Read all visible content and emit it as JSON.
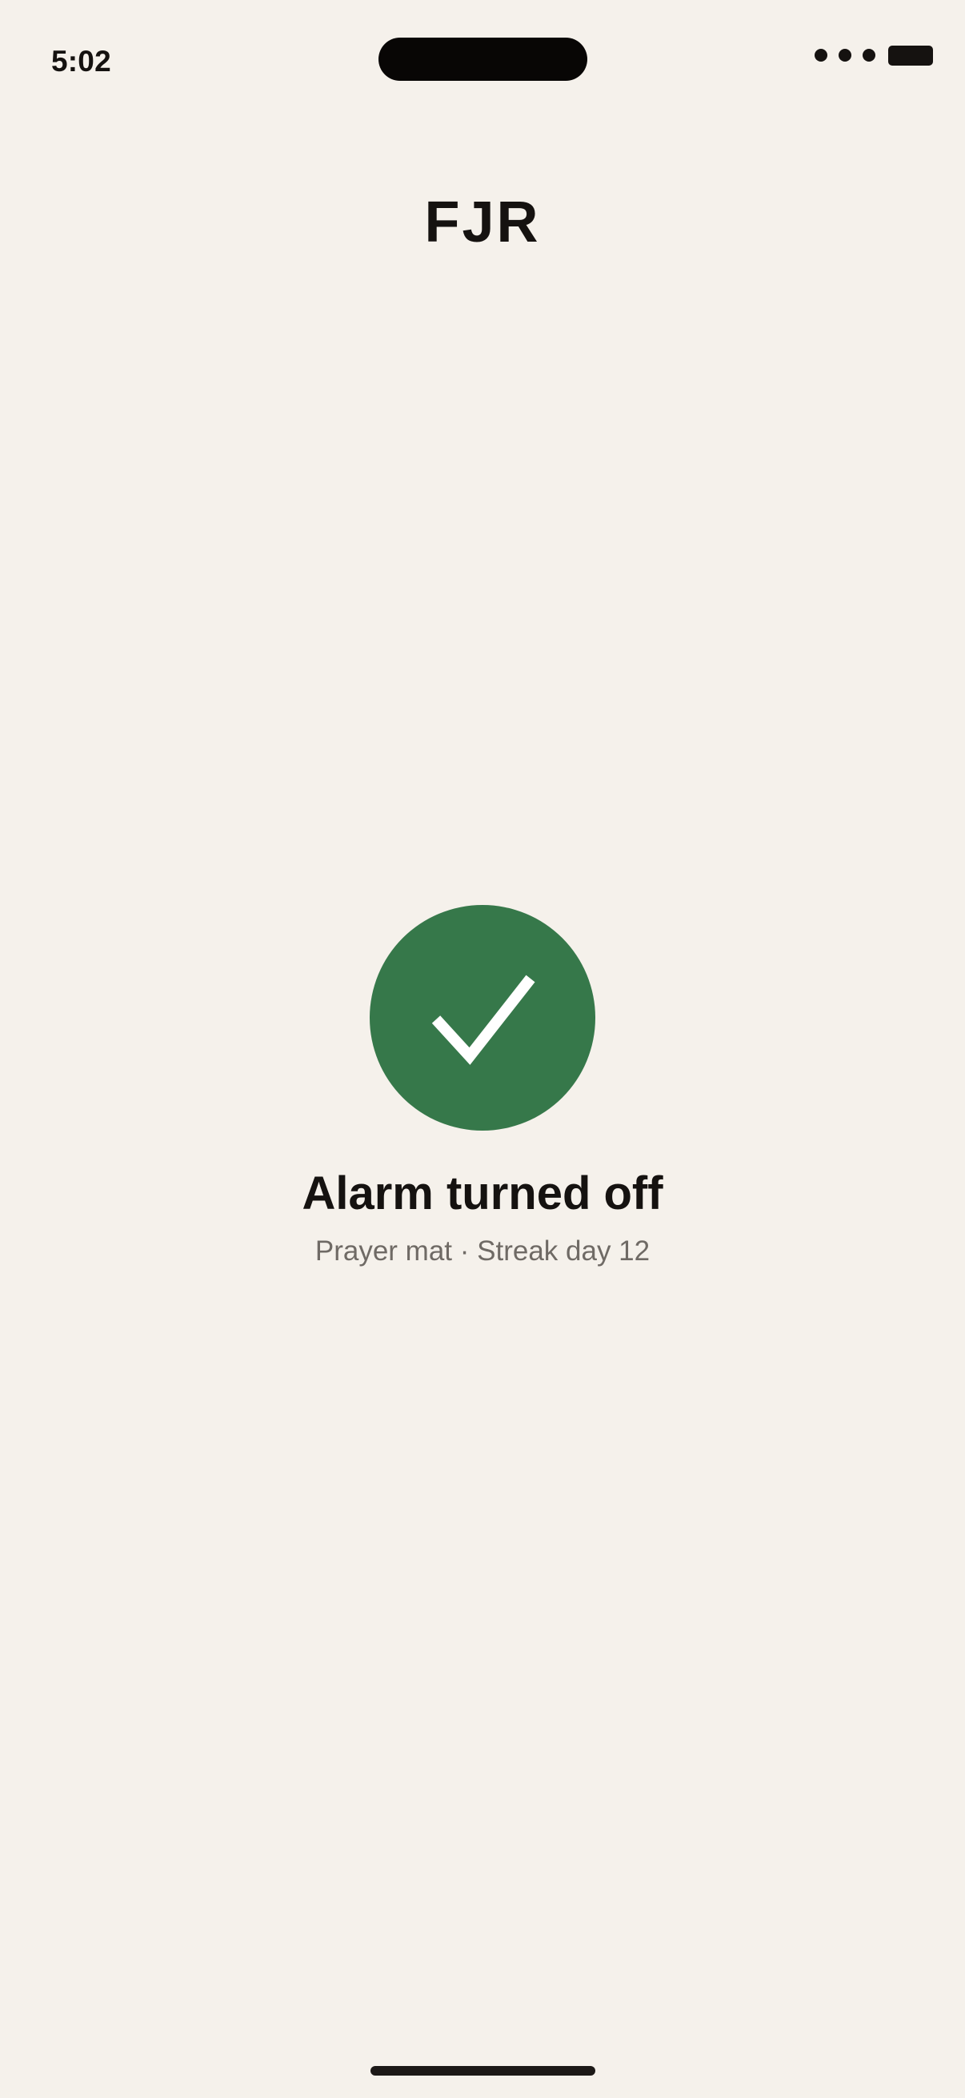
{
  "status_bar": {
    "time": "5:02"
  },
  "header": {
    "title": "FJR"
  },
  "confirmation": {
    "icon": "checkmark-icon",
    "title": "Alarm turned off",
    "subtitle": "Prayer mat · Streak day 12"
  },
  "colors": {
    "background": "#F5F1EB",
    "success": "#36784A",
    "text_primary": "#151210",
    "text_secondary": "#6F6A65"
  }
}
